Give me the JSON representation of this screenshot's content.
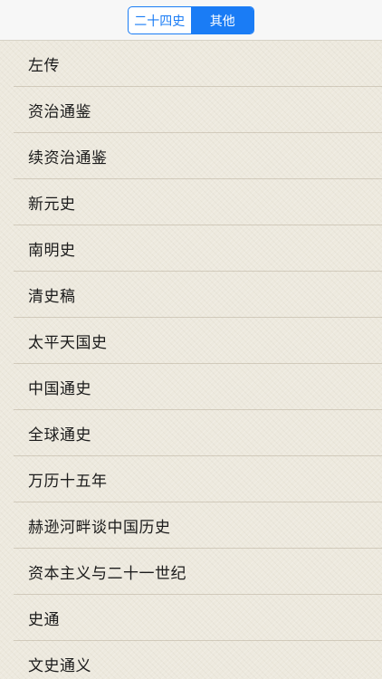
{
  "segmented_control": {
    "options": [
      "二十四史",
      "其他"
    ],
    "selected_index": 1
  },
  "books": [
    "左传",
    "资治通鉴",
    "续资治通鉴",
    "新元史",
    "南明史",
    "清史稿",
    "太平天国史",
    "中国通史",
    "全球通史",
    "万历十五年",
    "赫逊河畔谈中国历史",
    "资本主义与二十一世纪",
    "史通",
    "文史通义"
  ],
  "colors": {
    "accent": "#1a7cf5",
    "background": "#ede9de",
    "nav_background": "#f7f7f7",
    "text": "#1b1b1b"
  }
}
